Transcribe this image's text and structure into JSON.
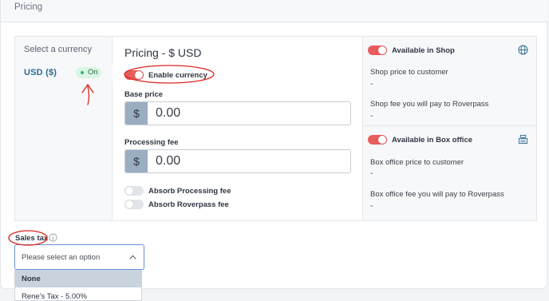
{
  "card": {
    "title": "Pricing"
  },
  "currency_list": {
    "title": "Select a currency",
    "items": [
      {
        "label": "USD  ($)",
        "status": "On"
      }
    ]
  },
  "pricing": {
    "title": "Pricing - $ USD",
    "enable_currency_label": "Enable currency",
    "base_price": {
      "label": "Base price",
      "prefix": "$",
      "value": "0.00"
    },
    "processing_fee": {
      "label": "Processing fee",
      "prefix": "$",
      "value": "0.00"
    },
    "absorb_processing_label": "Absorb Processing fee",
    "absorb_roverpass_label": "Absorb Roverpass fee"
  },
  "shop": {
    "toggle_label": "Available in Shop",
    "price_label": "Shop price to customer",
    "price_value": "-",
    "fee_label": "Shop fee you will pay to Roverpass",
    "fee_value": "-"
  },
  "box_office": {
    "toggle_label": "Available in Box office",
    "price_label": "Box office price to customer",
    "price_value": "-",
    "fee_label": "Box office fee you will pay to Roverpass",
    "fee_value": "-"
  },
  "sales_tax": {
    "label": "Sales tax",
    "placeholder": "Please select an option",
    "options": [
      "None",
      "Rene's Tax - 5.00%"
    ]
  },
  "colors": {
    "toggle_on": "#e85c5c",
    "badge_bg": "#d9f5e4",
    "annotation": "#d8261f",
    "accent_blue": "#2c6a8f"
  }
}
